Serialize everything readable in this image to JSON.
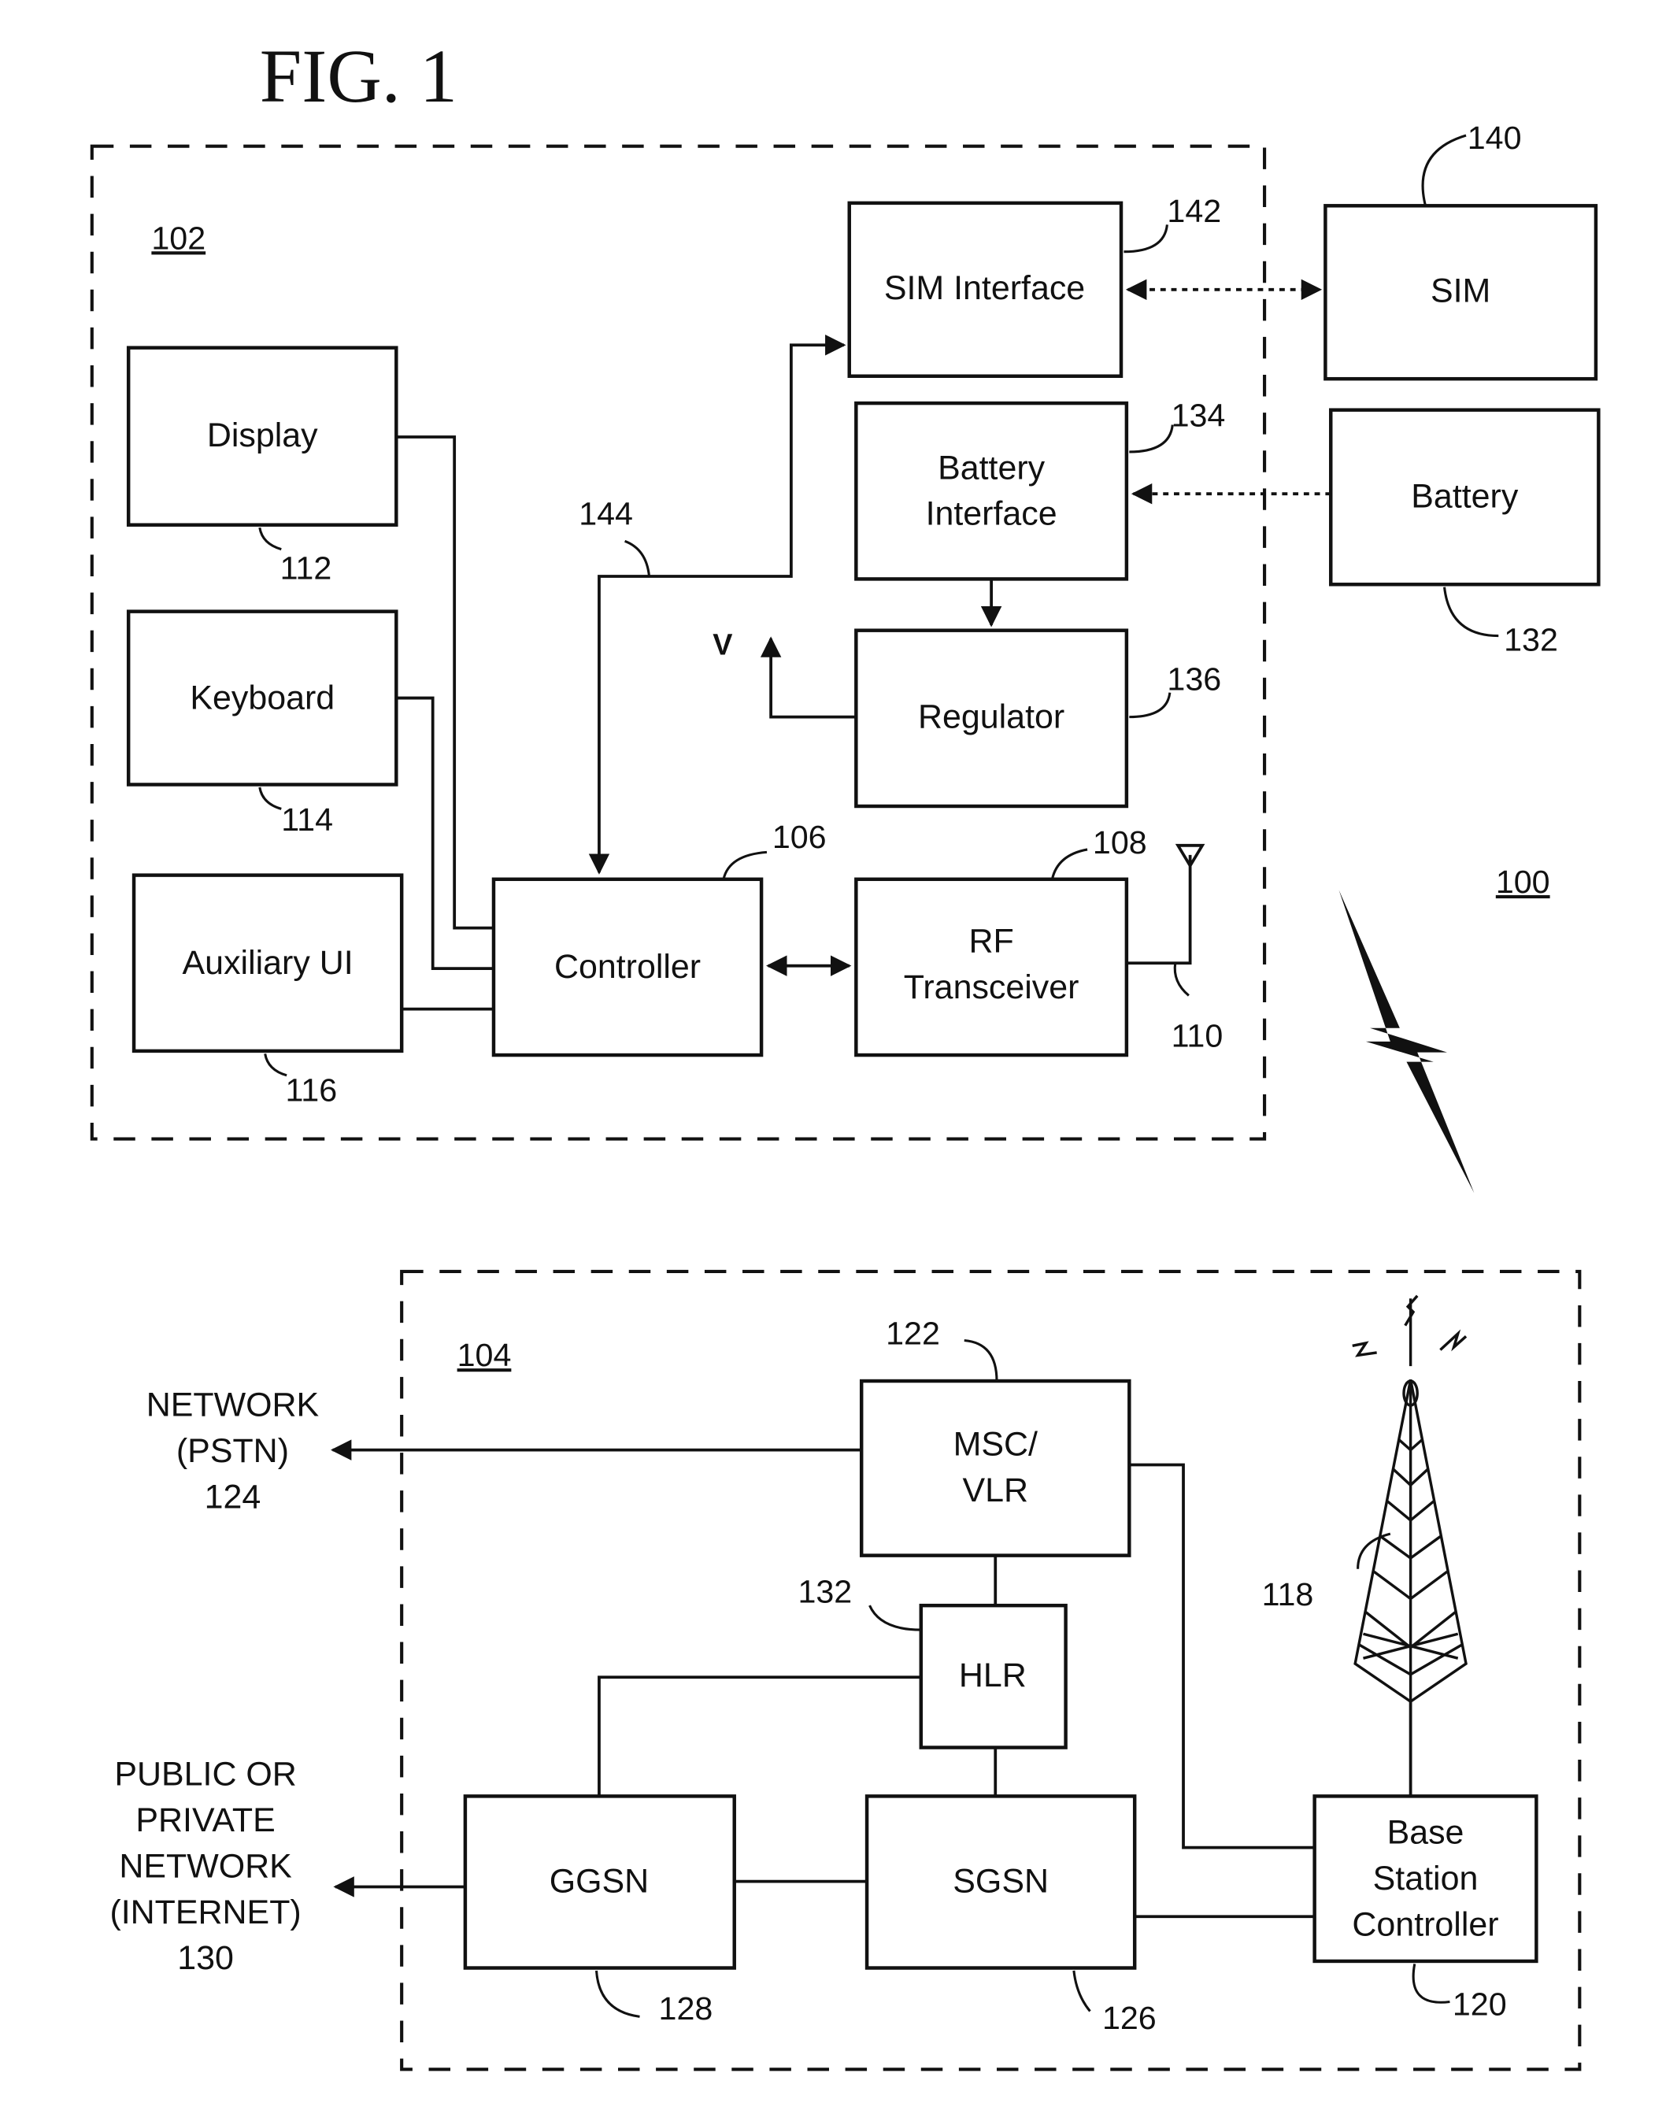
{
  "figure": {
    "title": "FIG. 1",
    "system_ref": "100"
  },
  "mobile_device": {
    "ref": "102",
    "blocks": {
      "display": {
        "label": "Display",
        "ref": "112"
      },
      "keyboard": {
        "label": "Keyboard",
        "ref": "114"
      },
      "auxiliary_ui": {
        "label": "Auxiliary UI",
        "ref": "116"
      },
      "controller": {
        "label": "Controller",
        "ref": "106"
      },
      "rf_transceiver": {
        "label_line1": "RF",
        "label_line2": "Transceiver",
        "ref": "108"
      },
      "sim_interface": {
        "label": "SIM Interface",
        "ref": "142"
      },
      "battery_interface": {
        "label_line1": "Battery",
        "label_line2": "Interface",
        "ref": "134"
      },
      "regulator": {
        "label": "Regulator",
        "ref": "136"
      }
    },
    "antenna_ref": "110",
    "bus_ref": "144",
    "voltage_label": "V"
  },
  "external": {
    "sim": {
      "label": "SIM",
      "ref": "140"
    },
    "battery": {
      "label": "Battery",
      "ref": "132"
    }
  },
  "wireless_network": {
    "ref": "104",
    "blocks": {
      "msc_vlr": {
        "label_line1": "MSC/",
        "label_line2": "VLR",
        "ref": "122"
      },
      "hlr": {
        "label": "HLR",
        "ref": "132"
      },
      "ggsn": {
        "label": "GGSN",
        "ref": "128"
      },
      "sgsn": {
        "label": "SGSN",
        "ref": "126"
      },
      "bsc": {
        "label_line1": "Base",
        "label_line2": "Station",
        "label_line3": "Controller",
        "ref": "120"
      }
    },
    "tower_ref": "118"
  },
  "external_networks": {
    "pstn": {
      "line1": "NETWORK",
      "line2": "(PSTN)",
      "ref": "124"
    },
    "internet": {
      "line1": "PUBLIC OR",
      "line2": "PRIVATE",
      "line3": "NETWORK",
      "line4": "(INTERNET)",
      "ref": "130"
    }
  }
}
